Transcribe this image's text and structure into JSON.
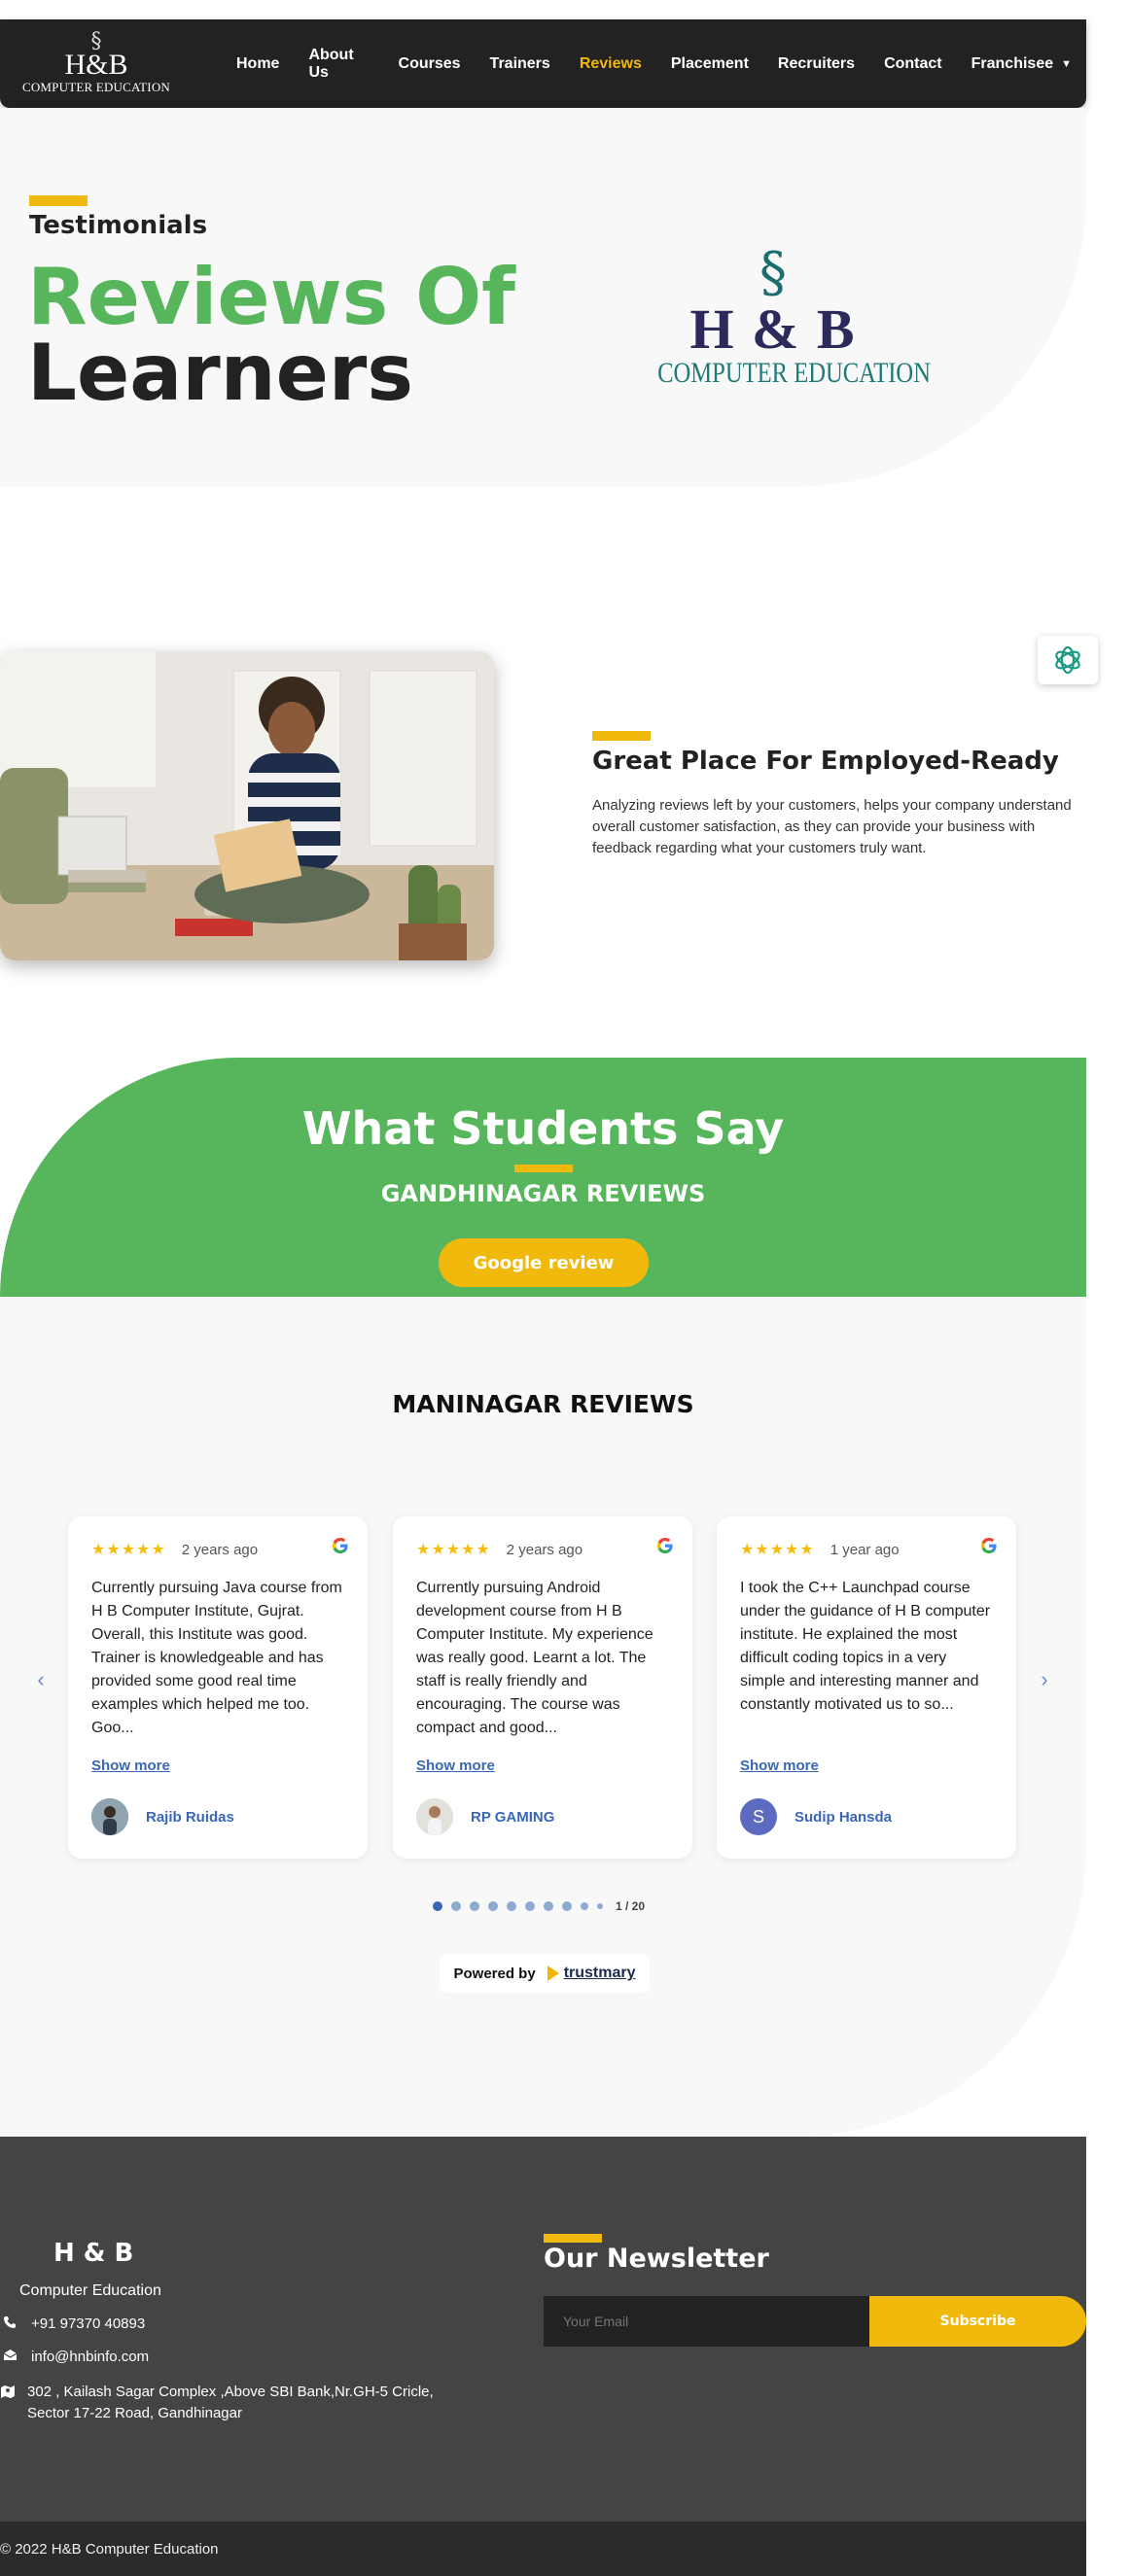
{
  "nav": {
    "logo_brand": "H&B",
    "logo_sub": "COMPUTER EDUCATION",
    "items": [
      {
        "label": "Home"
      },
      {
        "label": "About Us"
      },
      {
        "label": "Courses"
      },
      {
        "label": "Trainers"
      },
      {
        "label": "Reviews",
        "active": true
      },
      {
        "label": "Placement"
      },
      {
        "label": "Recruiters"
      },
      {
        "label": "Contact"
      },
      {
        "label": "Franchisee",
        "dropdown": true
      }
    ]
  },
  "hero": {
    "kicker": "Testimonials",
    "title_line1": "Reviews Of",
    "title_line2": "Learners",
    "logo_brand": "H & B",
    "logo_sub": "COMPUTER EDUCATION"
  },
  "employed": {
    "title": "Great Place For Employed-Ready",
    "text": "Analyzing reviews left by your customers, helps your company understand overall customer satisfaction, as they can provide your business with feedback regarding what your customers truly want."
  },
  "students": {
    "title": "What Students Say",
    "subtitle": "GANDHINAGAR REVIEWS",
    "button": "Google review"
  },
  "reviews": {
    "title": "MANINAGAR REVIEWS",
    "show_more": "Show more",
    "items": [
      {
        "stars": "★★★★★",
        "ago": "2 years ago",
        "text": "Currently pursuing Java course from H B Computer Institute, Gujrat. Overall, this Institute was good. Trainer is knowledgeable and has provided some good real time examples which helped me too. Goo...",
        "author": "Rajib Ruidas"
      },
      {
        "stars": "★★★★★",
        "ago": "2 years ago",
        "text": "Currently pursuing Android development course from H B Computer Institute. My experience was really good. Learnt a lot. The staff is really friendly and encouraging. The course was compact and good...",
        "author": "RP GAMING"
      },
      {
        "stars": "★★★★★",
        "ago": "1 year ago",
        "text": "I took the C++ Launchpad course under the guidance of H B computer institute. He explained the most difficult coding topics in a very simple and interesting manner and constantly motivated us to so...",
        "author": "Sudip Hansda",
        "initial": "S"
      }
    ],
    "page_counter": "1 / 20",
    "powered_by": "Powered by",
    "powered_brand": "trustmary"
  },
  "footer": {
    "brand": "H & B",
    "brand_sub": "Computer Education",
    "phone": "+91 97370 40893",
    "email": "info@hnbinfo.com",
    "address": "302 , Kailash Sagar Complex ,Above SBI Bank,Nr.GH-5 Cricle, Sector 17-22 Road, Gandhinagar",
    "newsletter_title": "Our Newsletter",
    "email_placeholder": "Your Email",
    "subscribe": "Subscribe",
    "copyright": "© 2022 H&B Computer Education"
  },
  "colors": {
    "accent": "#f1b90c",
    "green": "#57b65b",
    "dark": "#222222",
    "link": "#3a67b5"
  }
}
